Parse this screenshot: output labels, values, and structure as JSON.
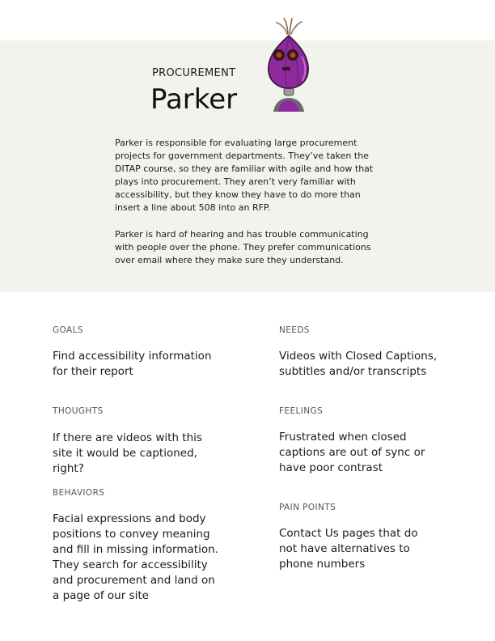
{
  "persona": {
    "role": "PROCUREMENT",
    "name": "Parker",
    "bio": [
      "Parker is responsible for evaluating large procurement projects for government departments. They’ve taken the DITAP course, so they are familiar with agile and how that plays into procurement. They aren’t very familiar with accessibility, but they know they have to do more than insert a line about 508 into an RFP.",
      "Parker is hard of hearing and has trouble communicating with people over the phone. They prefer communications over email where they make sure they understand."
    ]
  },
  "sections": {
    "goals": {
      "label": "GOALS",
      "text": "Find accessibility information for their report"
    },
    "needs": {
      "label": "NEEDS",
      "text": "Videos with Closed Captions, subtitles and/or transcripts"
    },
    "thoughts": {
      "label": "THOUGHTS",
      "text": "If there are videos with this site it would be captioned, right?"
    },
    "feelings": {
      "label": "FEELINGS",
      "text": "Frustrated when closed captions are out of sync or have poor contrast"
    },
    "behaviors": {
      "label": "BEHAVIORS",
      "text": "Facial expressions and body positions to convey meaning and fill in missing information. They search for accessibility and procurement and land on a page of our site"
    },
    "pain_points": {
      "label": "PAIN POINTS",
      "text": "Contact Us pages that do not have alternatives to phone numbers"
    }
  },
  "icons": {
    "avatar": "onion-robot-icon"
  },
  "colors": {
    "hero_background": "#f3f3ee",
    "avatar_purple": "#8e2a9e"
  }
}
